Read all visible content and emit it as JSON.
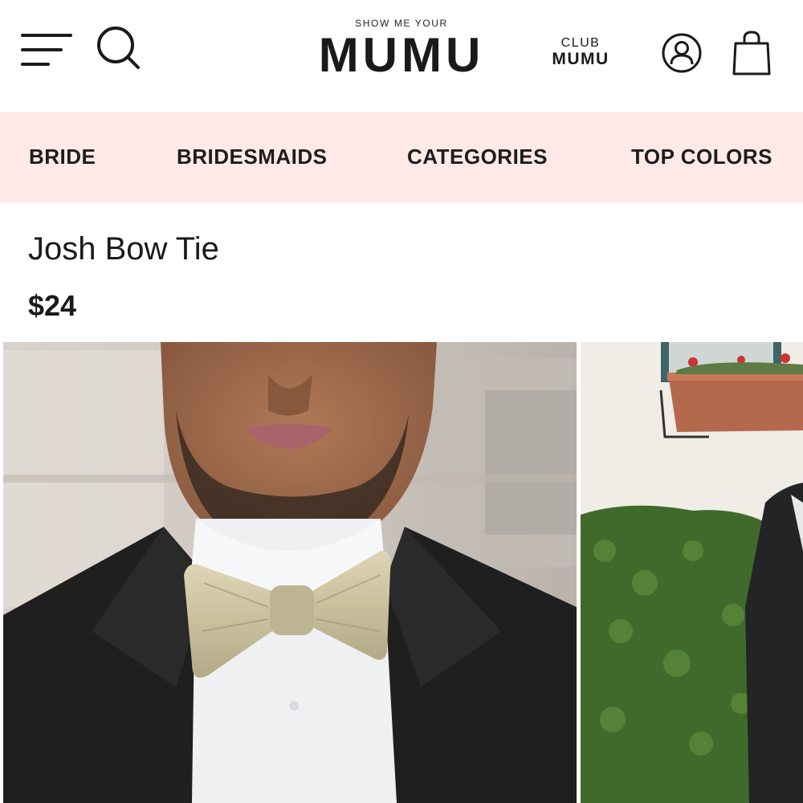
{
  "header": {
    "logo_small": "SHOW ME YOUR",
    "logo_big": "MUMU",
    "club_top": "CLUB",
    "club_bottom": "MUMU",
    "icons": [
      "menu-icon",
      "search-icon",
      "account-icon",
      "shopping-bag-icon"
    ]
  },
  "nav": {
    "items": [
      {
        "label": "BRIDE"
      },
      {
        "label": "BRIDESMAIDS"
      },
      {
        "label": "CATEGORIES"
      },
      {
        "label": "TOP COLORS"
      }
    ],
    "background": "#fde9e6"
  },
  "product": {
    "title": "Josh Bow Tie",
    "price": "$24"
  },
  "colors": {
    "text": "#1d1d1d",
    "nav_bg": "#fde9e6",
    "bow_tie": "#cfc6a2"
  }
}
